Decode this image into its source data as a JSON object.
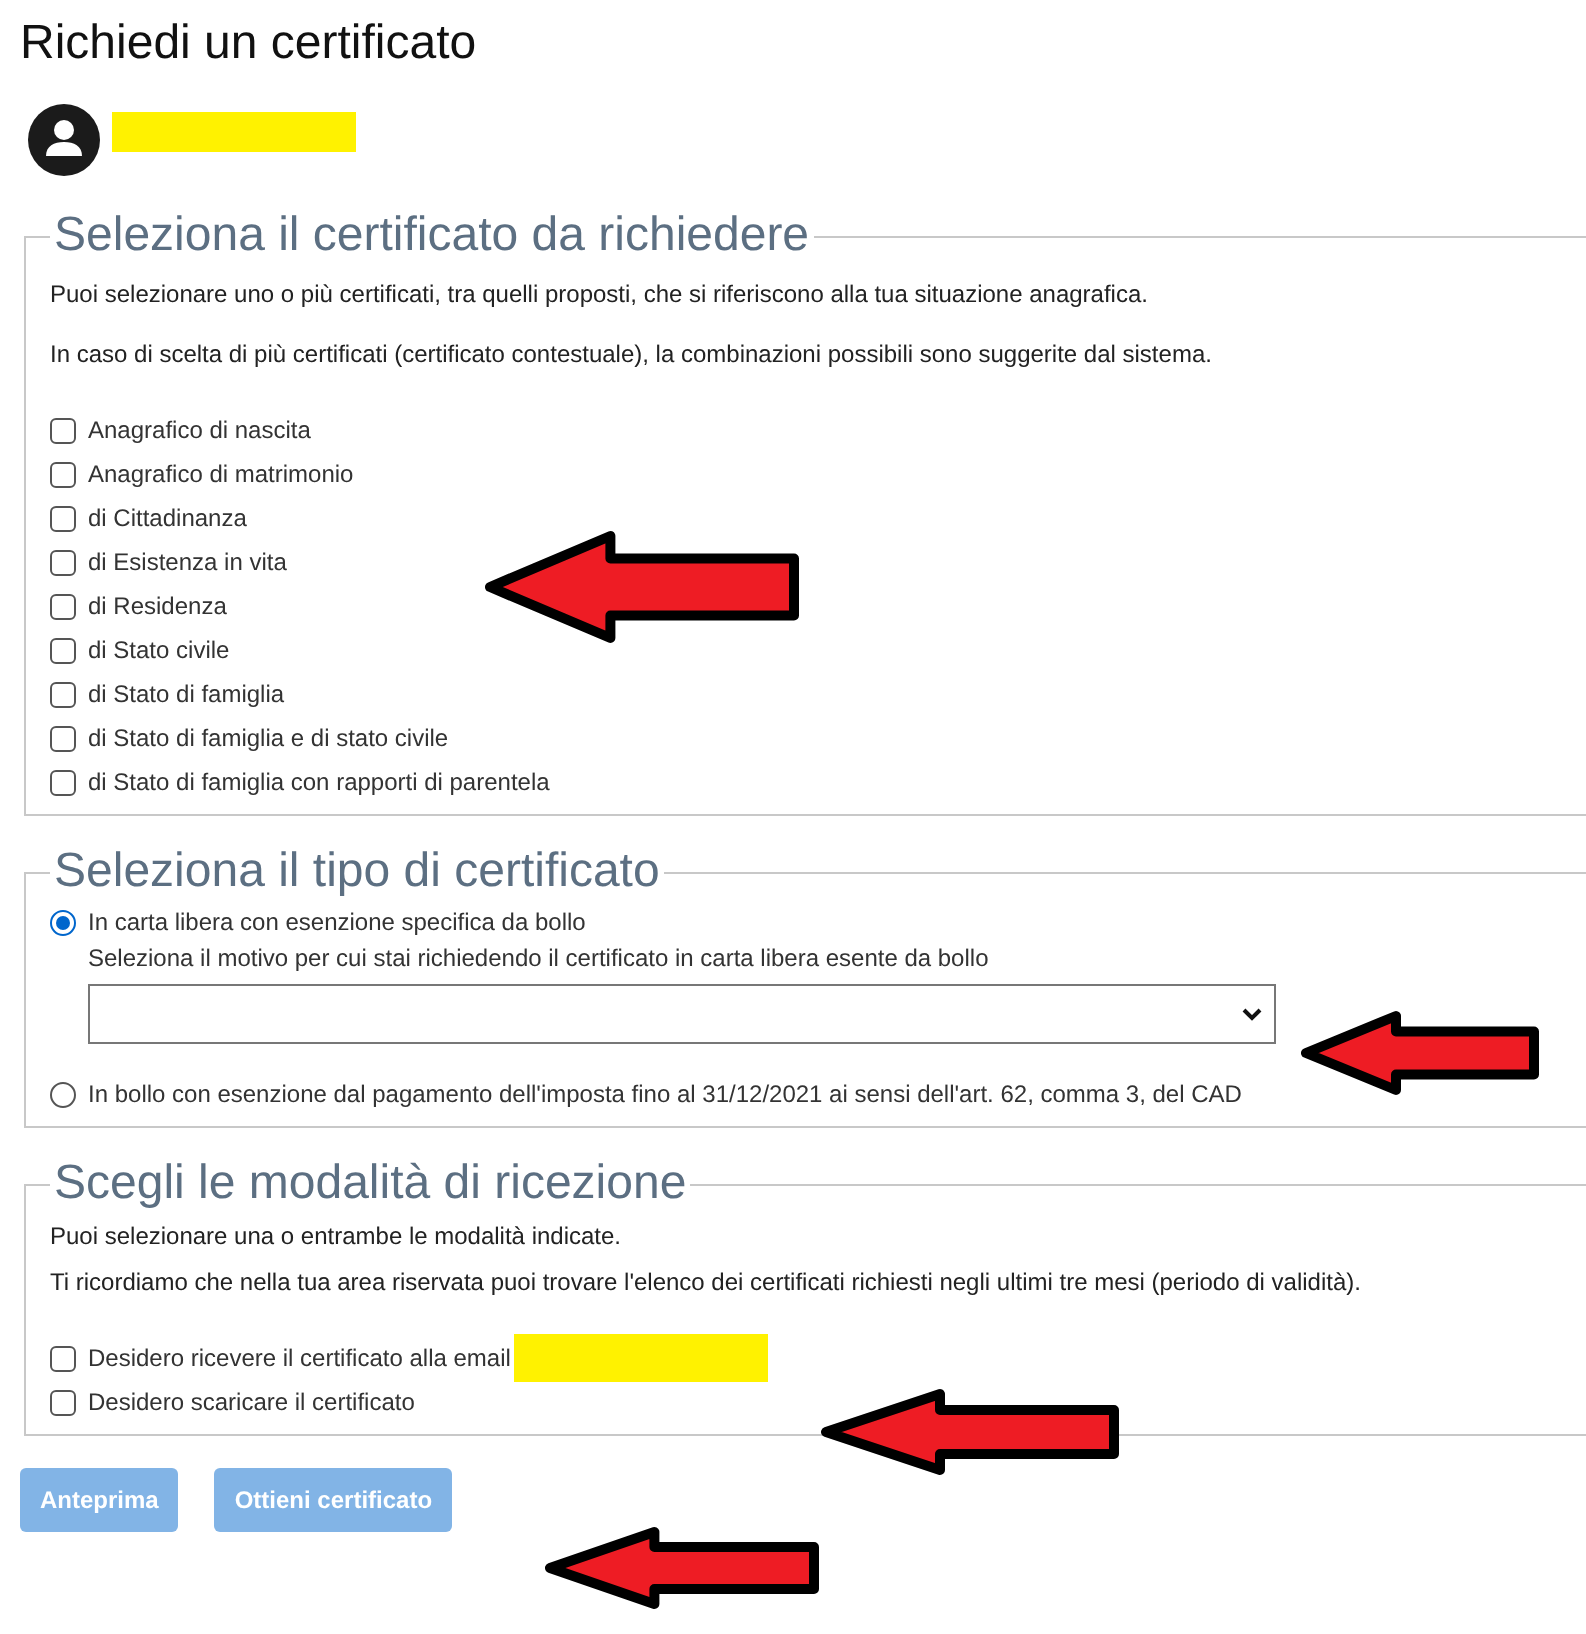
{
  "title": "Richiedi un certificato",
  "sections": [
    {
      "kind": "certificates",
      "legend": "Seleziona il certificato da richiedere",
      "notes": [
        "Puoi selezionare uno o più certificati, tra quelli proposti, che si riferiscono alla tua situazione anagrafica.",
        "In caso di scelta di più certificati (certificato contestuale), la combinazioni possibili sono suggerite dal sistema."
      ],
      "options": [
        {
          "label": "Anagrafico di nascita",
          "checked": false
        },
        {
          "label": "Anagrafico di matrimonio",
          "checked": false
        },
        {
          "label": "di Cittadinanza",
          "checked": false
        },
        {
          "label": "di Esistenza in vita",
          "checked": false
        },
        {
          "label": "di Residenza",
          "checked": false
        },
        {
          "label": "di Stato civile",
          "checked": false
        },
        {
          "label": "di Stato di famiglia",
          "checked": false
        },
        {
          "label": "di Stato di famiglia e di stato civile",
          "checked": false
        },
        {
          "label": "di Stato di famiglia con rapporti di parentela",
          "checked": false
        }
      ]
    },
    {
      "kind": "type",
      "legend": "Seleziona il tipo di certificato",
      "options": [
        {
          "label": "In carta libera con esenzione specifica da bollo",
          "selected": true,
          "select_label": "Seleziona il motivo per cui stai richiedendo il certificato in carta libera esente da bollo"
        },
        {
          "label": "In bollo con esenzione dal pagamento dell'imposta fino al 31/12/2021 ai sensi dell'art. 62, comma 3, del CAD",
          "selected": false
        }
      ]
    },
    {
      "kind": "delivery",
      "legend": "Scegli le modalità di ricezione",
      "notes": [
        "Puoi selezionare una o entrambe le modalità indicate.",
        "Ti ricordiamo che nella tua area riservata puoi trovare l'elenco dei certificati richiesti negli ultimi tre mesi (periodo di validità)."
      ],
      "options": [
        {
          "label": "Desidero ricevere il certificato alla email",
          "checked": false,
          "redacted": true
        },
        {
          "label": "Desidero scaricare il certificato",
          "checked": false
        }
      ]
    }
  ],
  "buttons": [
    {
      "label": "Anteprima",
      "disabled": true
    },
    {
      "label": "Ottieni certificato",
      "disabled": true
    }
  ]
}
